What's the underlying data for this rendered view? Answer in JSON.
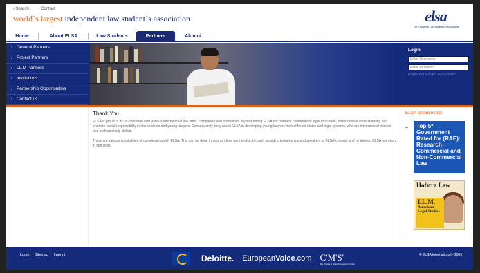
{
  "top_links": [
    "Search",
    "Contact"
  ],
  "tagline": {
    "prefix": "world´s largest",
    "rest": " independent law student´s association"
  },
  "logo": {
    "word": "elsa",
    "subtitle": "The European Law Students' Association"
  },
  "nav_tabs": [
    {
      "label": "Home",
      "active": false
    },
    {
      "label": "About ELSA",
      "active": false
    },
    {
      "label": "Law Students",
      "active": false
    },
    {
      "label": "Partners",
      "active": true
    },
    {
      "label": "Alumni",
      "active": false
    }
  ],
  "sidebar": {
    "items": [
      {
        "label": "General Partners"
      },
      {
        "label": "Project Partners"
      },
      {
        "label": "LL.M Partners"
      },
      {
        "label": "Institutions"
      },
      {
        "label": "Partnership Opportunities"
      },
      {
        "label": "Contact us"
      }
    ]
  },
  "login": {
    "title": "Login",
    "username_placeholder": "Enter Username",
    "password_placeholder": "Enter Password",
    "register_label": "Register",
    "forgot_label": "Forgot Password?"
  },
  "main": {
    "title": "Thank You",
    "paragraphs": [
      "ELSA is proud of its co-operation with various international law firms, companies and institutions. By supporting ELSA our partners contribute to legal education, foster mutual understanding and promote social responsibility in law students and young lawyers. Consequently, they assist ELSA in developing young lawyers from different states and legal systems, who are international minded and professionally skilled.",
      "There are various possibilities of co-operating with ELSA. This can be done through a close partnership, through providing traineeships and speakers at ELSA's events and by training ELSA members in soft skills."
    ]
  },
  "recommends": {
    "title": "ELSA recommends",
    "ad1_text": "Top 5* Government Rated for (RAE): Research Commercial and Non-Commercial Law",
    "ad2": {
      "title": "Hofstra Law",
      "llm": "LL.M.",
      "sub": "American Legal Studies"
    }
  },
  "footer": {
    "links": [
      "Login",
      "Sitemap",
      "Imprint"
    ],
    "copyright": "© ELSA International - 2009",
    "sponsors": {
      "deloitte": "Deloitte.",
      "ev_light": "European",
      "ev_bold": "Voice",
      "ev_tail": ".com",
      "cms": "C'M'S'",
      "cms_sub": "The alliance of major European law firms"
    }
  },
  "colors": {
    "primary": "#142a7b",
    "accent": "#e0621a",
    "ad_blue": "#1c57b5"
  }
}
